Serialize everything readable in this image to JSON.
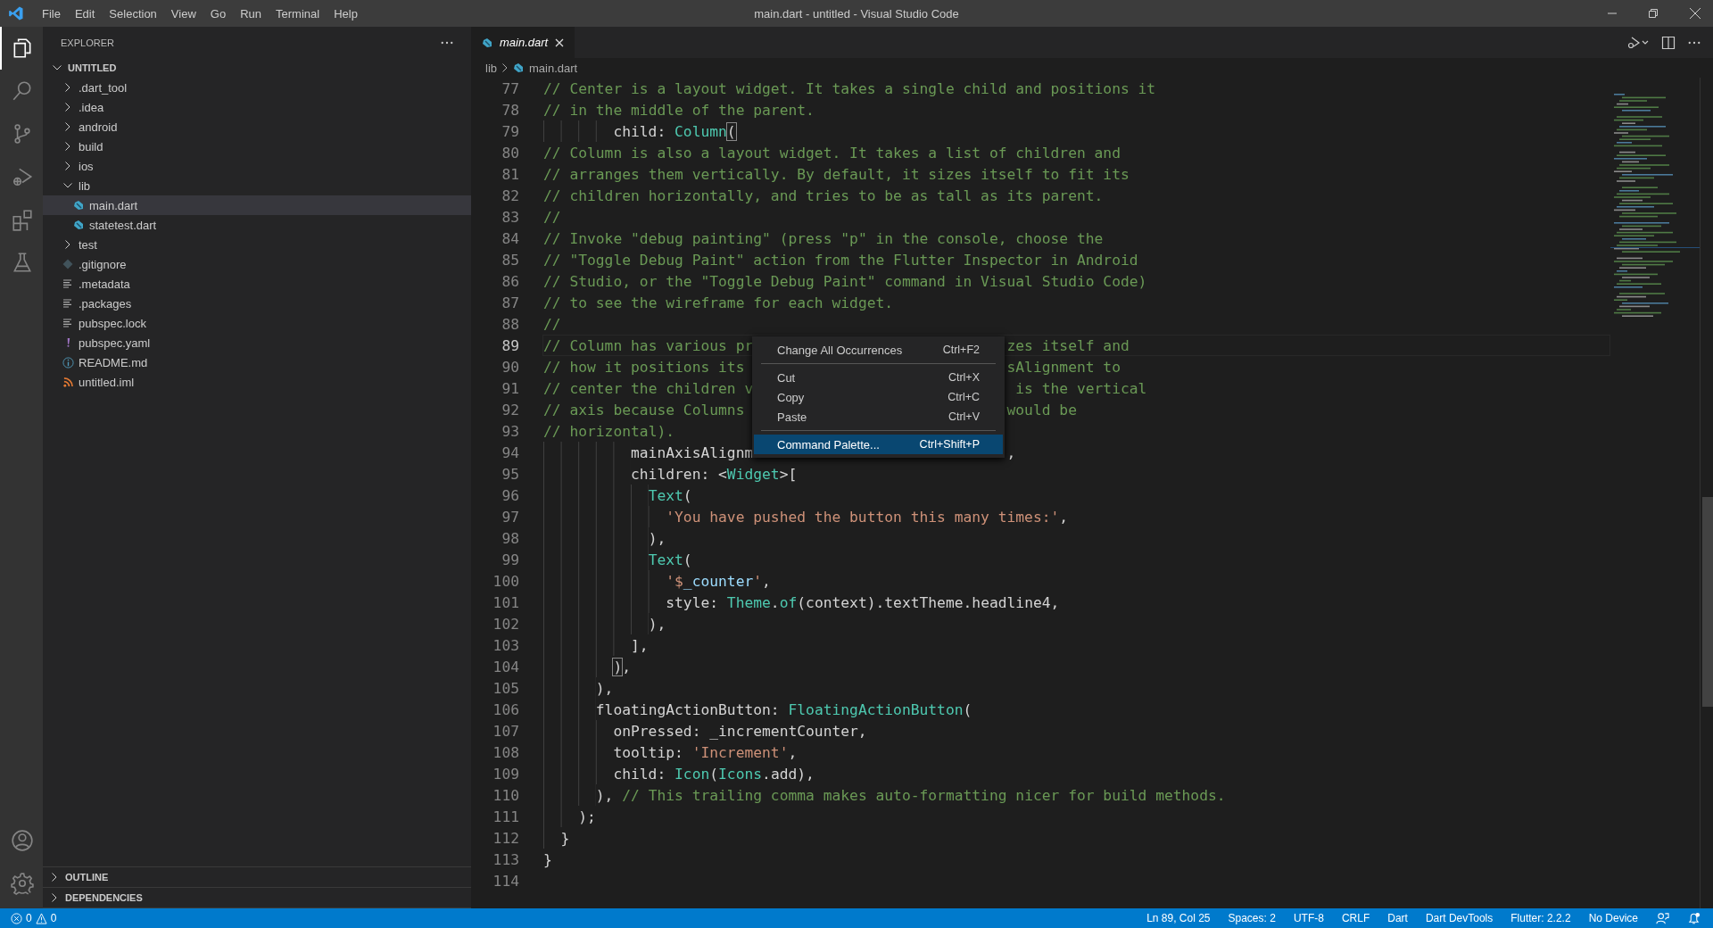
{
  "window": {
    "title": "main.dart - untitled - Visual Studio Code"
  },
  "menu_bar": [
    "File",
    "Edit",
    "Selection",
    "View",
    "Go",
    "Run",
    "Terminal",
    "Help"
  ],
  "activity_bar": [
    {
      "kind": "explorer",
      "selected": true
    },
    {
      "kind": "search",
      "selected": false
    },
    {
      "kind": "source-control",
      "selected": false
    },
    {
      "kind": "run",
      "selected": false
    },
    {
      "kind": "extensions",
      "selected": false
    },
    {
      "kind": "testing",
      "selected": false
    }
  ],
  "activity_bottom": [
    {
      "kind": "account"
    },
    {
      "kind": "settings"
    }
  ],
  "sidebar": {
    "title": "EXPLORER",
    "tree": [
      {
        "label": "UNTITLED",
        "kind": "root",
        "expanded": true,
        "selected": false,
        "children": [
          {
            "label": ".dart_tool",
            "kind": "folder",
            "expanded": false,
            "selected": false
          },
          {
            "label": ".idea",
            "kind": "folder",
            "expanded": false,
            "selected": false
          },
          {
            "label": "android",
            "kind": "folder",
            "expanded": false,
            "selected": false
          },
          {
            "label": "build",
            "kind": "folder",
            "expanded": false,
            "selected": false
          },
          {
            "label": "ios",
            "kind": "folder",
            "expanded": false,
            "selected": false
          },
          {
            "label": "lib",
            "kind": "folder",
            "expanded": true,
            "selected": false,
            "children": [
              {
                "label": "main.dart",
                "kind": "dart",
                "selected": true
              },
              {
                "label": "statetest.dart",
                "kind": "dart",
                "selected": false
              }
            ]
          },
          {
            "label": "test",
            "kind": "folder",
            "expanded": false,
            "selected": false
          },
          {
            "label": ".gitignore",
            "kind": "git",
            "selected": false
          },
          {
            "label": ".metadata",
            "kind": "text",
            "selected": false
          },
          {
            "label": ".packages",
            "kind": "text",
            "selected": false
          },
          {
            "label": "pubspec.lock",
            "kind": "text",
            "selected": false
          },
          {
            "label": "pubspec.yaml",
            "kind": "yaml",
            "selected": false
          },
          {
            "label": "README.md",
            "kind": "info",
            "selected": false
          },
          {
            "label": "untitled.iml",
            "kind": "feed",
            "selected": false
          }
        ]
      }
    ],
    "sections": [
      {
        "label": "OUTLINE",
        "expanded": false
      },
      {
        "label": "DEPENDENCIES",
        "expanded": false
      }
    ]
  },
  "tabs": [
    {
      "label": "main.dart",
      "selected": true
    }
  ],
  "breadcrumb": [
    "lib",
    "main.dart"
  ],
  "editor": {
    "lines": [
      {
        "n": "77",
        "current": false,
        "tokens": [
          {
            "kind": "comment",
            "text": "// Center is a layout widget. It takes a single child and positions it"
          }
        ]
      },
      {
        "n": "78",
        "current": false,
        "tokens": [
          {
            "kind": "comment",
            "text": "// in the middle of the parent."
          }
        ]
      },
      {
        "n": "79",
        "current": false,
        "tokens": [
          {
            "kind": "plain",
            "text": "        child: "
          },
          {
            "kind": "type",
            "text": "Column"
          },
          {
            "kind": "bracket",
            "text": "("
          }
        ]
      },
      {
        "n": "80",
        "current": false,
        "tokens": [
          {
            "kind": "comment",
            "text": "// Column is also a layout widget. It takes a list of children and"
          }
        ]
      },
      {
        "n": "81",
        "current": false,
        "tokens": [
          {
            "kind": "comment",
            "text": "// arranges them vertically. By default, it sizes itself to fit its"
          }
        ]
      },
      {
        "n": "82",
        "current": false,
        "tokens": [
          {
            "kind": "comment",
            "text": "// children horizontally, and tries to be as tall as its parent."
          }
        ]
      },
      {
        "n": "83",
        "current": false,
        "tokens": [
          {
            "kind": "comment",
            "text": "//"
          }
        ]
      },
      {
        "n": "84",
        "current": false,
        "tokens": [
          {
            "kind": "comment",
            "text": "// Invoke \"debug painting\" (press \"p\" in the console, choose the"
          }
        ]
      },
      {
        "n": "85",
        "current": false,
        "tokens": [
          {
            "kind": "comment",
            "text": "// \"Toggle Debug Paint\" action from the Flutter Inspector in Android"
          }
        ]
      },
      {
        "n": "86",
        "current": false,
        "tokens": [
          {
            "kind": "comment",
            "text": "// Studio, or the \"Toggle Debug Paint\" command in Visual Studio Code)"
          }
        ]
      },
      {
        "n": "87",
        "current": false,
        "tokens": [
          {
            "kind": "comment",
            "text": "// to see the wireframe for each widget."
          }
        ]
      },
      {
        "n": "88",
        "current": false,
        "tokens": [
          {
            "kind": "comment",
            "text": "//"
          }
        ]
      },
      {
        "n": "89",
        "current": true,
        "tokens": [
          {
            "kind": "comment",
            "text": "// Column has various pr"
          },
          {
            "kind": "gap"
          },
          {
            "kind": "comment",
            "text": "zes itself and"
          }
        ]
      },
      {
        "n": "90",
        "current": false,
        "tokens": [
          {
            "kind": "comment",
            "text": "// how it positions its"
          },
          {
            "kind": "gap"
          },
          {
            "kind": "comment",
            "text": "sAlignment to"
          }
        ]
      },
      {
        "n": "91",
        "current": false,
        "tokens": [
          {
            "kind": "comment",
            "text": "// center the children v"
          },
          {
            "kind": "gap"
          },
          {
            "kind": "comment",
            "text": " is the vertical"
          }
        ]
      },
      {
        "n": "92",
        "current": false,
        "tokens": [
          {
            "kind": "comment",
            "text": "// axis because Columns"
          },
          {
            "kind": "gap"
          },
          {
            "kind": "comment",
            "text": "would be"
          }
        ]
      },
      {
        "n": "93",
        "current": false,
        "tokens": [
          {
            "kind": "comment",
            "text": "// horizontal)."
          }
        ]
      },
      {
        "n": "94",
        "current": false,
        "tokens": [
          {
            "kind": "plain",
            "text": "          mainAxisAlignm"
          },
          {
            "kind": "gap"
          },
          {
            "kind": "plain",
            "text": ","
          }
        ]
      },
      {
        "n": "95",
        "current": false,
        "tokens": [
          {
            "kind": "plain",
            "text": "          children: <"
          },
          {
            "kind": "type",
            "text": "Widget"
          },
          {
            "kind": "plain",
            "text": ">["
          }
        ]
      },
      {
        "n": "96",
        "current": false,
        "tokens": [
          {
            "kind": "type",
            "text": "            Text"
          },
          {
            "kind": "plain",
            "text": "("
          }
        ]
      },
      {
        "n": "97",
        "current": false,
        "tokens": [
          {
            "kind": "string",
            "text": "              'You have pushed the button this many times:'"
          },
          {
            "kind": "plain",
            "text": ","
          }
        ]
      },
      {
        "n": "98",
        "current": false,
        "tokens": [
          {
            "kind": "plain",
            "text": "            ),"
          }
        ]
      },
      {
        "n": "99",
        "current": false,
        "tokens": [
          {
            "kind": "type",
            "text": "            Text"
          },
          {
            "kind": "plain",
            "text": "("
          }
        ]
      },
      {
        "n": "100",
        "current": false,
        "tokens": [
          {
            "kind": "string",
            "text": "              '$"
          },
          {
            "kind": "variable",
            "text": "_counter"
          },
          {
            "kind": "string",
            "text": "'"
          },
          {
            "kind": "plain",
            "text": ","
          }
        ]
      },
      {
        "n": "101",
        "current": false,
        "tokens": [
          {
            "kind": "plain",
            "text": "              style: "
          },
          {
            "kind": "type",
            "text": "Theme"
          },
          {
            "kind": "plain",
            "text": "."
          },
          {
            "kind": "type",
            "text": "of"
          },
          {
            "kind": "plain",
            "text": "(context).textTheme.headline4,"
          }
        ]
      },
      {
        "n": "102",
        "current": false,
        "tokens": [
          {
            "kind": "plain",
            "text": "            ),"
          }
        ]
      },
      {
        "n": "103",
        "current": false,
        "tokens": [
          {
            "kind": "plain",
            "text": "          ],"
          }
        ]
      },
      {
        "n": "104",
        "current": false,
        "tokens": [
          {
            "kind": "bracket",
            "text": "        )"
          },
          {
            "kind": "plain",
            "text": ","
          }
        ]
      },
      {
        "n": "105",
        "current": false,
        "tokens": [
          {
            "kind": "plain",
            "text": "      ),"
          }
        ]
      },
      {
        "n": "106",
        "current": false,
        "tokens": [
          {
            "kind": "plain",
            "text": "      floatingActionButton: "
          },
          {
            "kind": "type",
            "text": "FloatingActionButton"
          },
          {
            "kind": "plain",
            "text": "("
          }
        ]
      },
      {
        "n": "107",
        "current": false,
        "tokens": [
          {
            "kind": "plain",
            "text": "        onPressed: _incrementCounter,"
          }
        ]
      },
      {
        "n": "108",
        "current": false,
        "tokens": [
          {
            "kind": "plain",
            "text": "        tooltip: "
          },
          {
            "kind": "string",
            "text": "'Increment'"
          },
          {
            "kind": "plain",
            "text": ","
          }
        ]
      },
      {
        "n": "109",
        "current": false,
        "tokens": [
          {
            "kind": "plain",
            "text": "        child: "
          },
          {
            "kind": "type",
            "text": "Icon"
          },
          {
            "kind": "plain",
            "text": "("
          },
          {
            "kind": "type",
            "text": "Icons"
          },
          {
            "kind": "plain",
            "text": ".add),"
          }
        ]
      },
      {
        "n": "110",
        "current": false,
        "tokens": [
          {
            "kind": "plain",
            "text": "      ), "
          },
          {
            "kind": "comment",
            "text": "// This trailing comma makes auto-formatting nicer for build methods."
          }
        ]
      },
      {
        "n": "111",
        "current": false,
        "tokens": [
          {
            "kind": "plain",
            "text": "    );"
          }
        ]
      },
      {
        "n": "112",
        "current": false,
        "tokens": [
          {
            "kind": "plain",
            "text": "  }"
          }
        ]
      },
      {
        "n": "113",
        "current": false,
        "tokens": [
          {
            "kind": "plain",
            "text": "}"
          }
        ]
      },
      {
        "n": "114",
        "current": false
      }
    ]
  },
  "context_menu": {
    "items": [
      {
        "kind": "item",
        "label": "Change All Occurrences",
        "shortcut": "Ctrl+F2",
        "selected": false
      },
      {
        "kind": "separator"
      },
      {
        "kind": "item",
        "label": "Cut",
        "shortcut": "Ctrl+X",
        "selected": false
      },
      {
        "kind": "item",
        "label": "Copy",
        "shortcut": "Ctrl+C",
        "selected": false
      },
      {
        "kind": "item",
        "label": "Paste",
        "shortcut": "Ctrl+V",
        "selected": false
      },
      {
        "kind": "separator"
      },
      {
        "kind": "item",
        "label": "Command Palette...",
        "shortcut": "Ctrl+Shift+P",
        "selected": true
      }
    ]
  },
  "status_bar": {
    "errors": "0",
    "warnings": "0",
    "items": [
      "Ln 89, Col 25",
      "Spaces: 2",
      "UTF-8",
      "CRLF",
      "Dart",
      "Dart DevTools",
      "Flutter: 2.2.2",
      "No Device"
    ]
  }
}
